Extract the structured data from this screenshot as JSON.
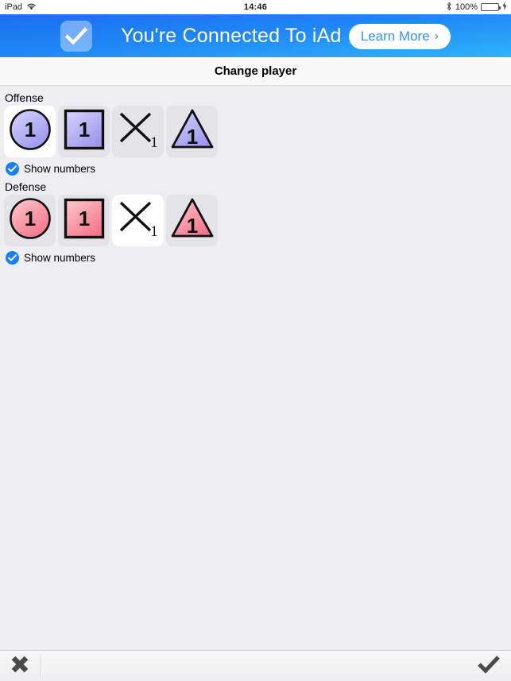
{
  "statusbar": {
    "device": "iPad",
    "wifi_icon": "wifi-icon",
    "time": "14:46",
    "bluetooth_icon": "bluetooth-icon",
    "battery_percent": "100%",
    "battery_level": 100,
    "battery_color": "#4cd551",
    "charging": true
  },
  "ad": {
    "check_icon": "checkmark-icon",
    "headline": "You're Connected To iAd",
    "cta_label": "Learn More",
    "cta_chevron": "chevron-right-icon",
    "gradient_top": "#1a6ff0",
    "gradient_bottom": "#2fb3fb",
    "cta_text_color": "#3a93e8"
  },
  "titlebar": {
    "title": "Change player"
  },
  "sections": [
    {
      "id": "offense",
      "label": "Offense",
      "accent": "#9a96ee",
      "accent_light": "#d8d5fb",
      "selected_index": 0,
      "tiles": [
        {
          "name": "circle-player-icon",
          "shape": "circle",
          "number": "1"
        },
        {
          "name": "square-player-icon",
          "shape": "square",
          "number": "1"
        },
        {
          "name": "cross-player-icon",
          "shape": "cross",
          "number": "1"
        },
        {
          "name": "triangle-player-icon",
          "shape": "triangle",
          "number": "1"
        }
      ],
      "checkbox": {
        "label": "Show numbers",
        "checked": true
      }
    },
    {
      "id": "defense",
      "label": "Defense",
      "accent": "#f4748a",
      "accent_light": "#fcc9cd",
      "selected_index": 2,
      "tiles": [
        {
          "name": "circle-player-icon",
          "shape": "circle",
          "number": "1"
        },
        {
          "name": "square-player-icon",
          "shape": "square",
          "number": "1"
        },
        {
          "name": "cross-player-icon",
          "shape": "cross",
          "number": "1"
        },
        {
          "name": "triangle-player-icon",
          "shape": "triangle",
          "number": "1"
        }
      ],
      "checkbox": {
        "label": "Show numbers",
        "checked": true
      }
    }
  ],
  "toolbar": {
    "cancel_icon": "close-x-icon",
    "confirm_icon": "checkmark-icon",
    "icon_color": "#4a4a4a"
  }
}
